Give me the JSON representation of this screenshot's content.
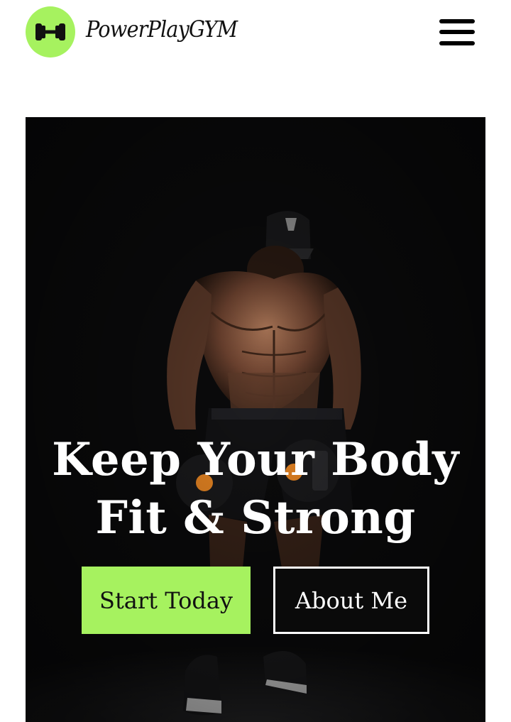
{
  "header": {
    "brand": "PowerPlayGYM",
    "logo_icon": "dumbbell-icon",
    "menu_icon": "hamburger-menu-icon"
  },
  "hero": {
    "headline_line1": "Keep Your Body",
    "headline_line2": "Fit & Strong",
    "primary_button": "Start Today",
    "secondary_button": "About Me",
    "image": "athlete-with-dumbbells-photo"
  },
  "colors": {
    "accent": "#a6f25f",
    "hero_background": "#0b0b0c",
    "text_dark": "#111111",
    "text_light": "#ffffff"
  }
}
